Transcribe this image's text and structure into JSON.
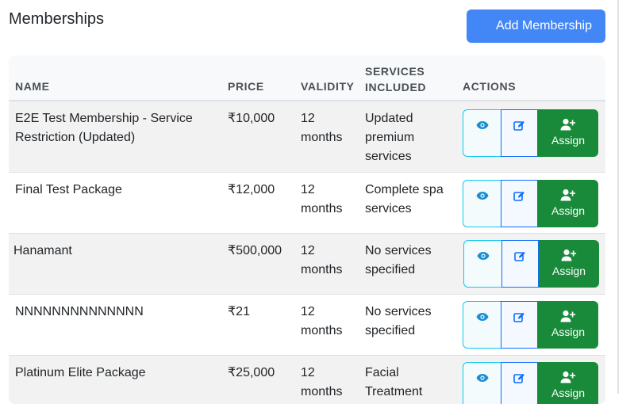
{
  "page": {
    "title": "Memberships",
    "add_button_label": "Add Membership"
  },
  "table": {
    "columns": [
      "NAME",
      "PRICE",
      "VALIDITY",
      "SERVICES INCLUDED",
      "ACTIONS"
    ],
    "rows": [
      {
        "name": "E2E Test Membership - Service Restriction (Updated)",
        "price": "₹10,000",
        "validity": "12 months",
        "services": "Updated premium services",
        "assign_label": "Assign"
      },
      {
        "name": "Final Test Package",
        "price": "₹12,000",
        "validity": "12 months",
        "services": "Complete spa services",
        "assign_label": "Assign"
      },
      {
        "name": "Hanamant",
        "price": "₹500,000",
        "validity": "12 months",
        "services": "No services specified",
        "assign_label": "Assign"
      },
      {
        "name": "NNNNNNNNNNNNNN",
        "price": "₹21",
        "validity": "12 months",
        "services": "No services specified",
        "assign_label": "Assign"
      },
      {
        "name": "Platinum Elite Package",
        "price": "₹25,000",
        "validity": "12 months",
        "services": "Facial Treatment",
        "assign_label": "Assign"
      }
    ]
  },
  "icons": {
    "view": "eye-icon",
    "edit": "edit-icon",
    "assign": "user-plus-icon"
  },
  "colors": {
    "primary": "#4287f5",
    "view_border": "#0dcaf0",
    "edit_border": "#0d6efd",
    "assign_bg": "#198a3a"
  }
}
